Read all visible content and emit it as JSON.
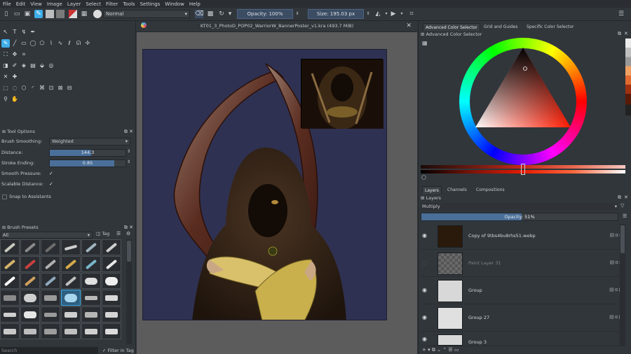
{
  "menu": [
    "File",
    "Edit",
    "View",
    "Image",
    "Layer",
    "Select",
    "Filter",
    "Tools",
    "Settings",
    "Window",
    "Help"
  ],
  "toolbar": {
    "blend_mode": "Normal",
    "opacity": "Opacity: 100%",
    "size": "Size: 195.03 px"
  },
  "document": {
    "title": "KT01_3_PhotoD_POP02_WarriorW_BannerPoster_v1.kra (493.7 MiB)"
  },
  "tool_options": {
    "title": "Tool Options",
    "brush_smoothing_label": "Brush Smoothing:",
    "brush_smoothing_value": "Weighted",
    "distance_label": "Distance:",
    "distance_value": "144.3",
    "distance_fraction": 0.55,
    "stroke_ending_label": "Stroke Ending:",
    "stroke_ending_value": "0.85",
    "stroke_ending_fraction": 0.85,
    "smooth_pressure_label": "Smooth Pressure:",
    "smooth_pressure_checked": true,
    "scalable_distance_label": "Scalable Distance:",
    "scalable_distance_checked": true,
    "snap_label": "Snap to Assistants"
  },
  "brush_presets": {
    "title": "Brush Presets",
    "filter_value": "All",
    "tag_label": "Tag",
    "search_placeholder": "Search",
    "filter_in_tag_label": "Filter in Tag"
  },
  "color_panel": {
    "tabs": [
      "Advanced Color Selector",
      "Grid and Guides",
      "Specific Color Selector"
    ],
    "active_tab": "Advanced Color Selector",
    "subtitle": "Advanced Color Selector"
  },
  "layers_panel": {
    "tabs": [
      "Layers",
      "Channels",
      "Compositions"
    ],
    "title": "Layers",
    "blend_mode": "Multiply",
    "opacity_label": "Opacity:",
    "opacity_value": "51%",
    "opacity_fraction": 0.51,
    "layers": [
      {
        "name": "Copy of 9tbs4bu8rhs51.webp",
        "visible": true,
        "dim": false
      },
      {
        "name": "Paint Layer 31",
        "visible": false,
        "dim": true
      },
      {
        "name": "Group",
        "visible": true,
        "dim": false
      },
      {
        "name": "Group 27",
        "visible": true,
        "dim": false
      },
      {
        "name": "Group 3",
        "visible": true,
        "dim": false
      }
    ]
  }
}
